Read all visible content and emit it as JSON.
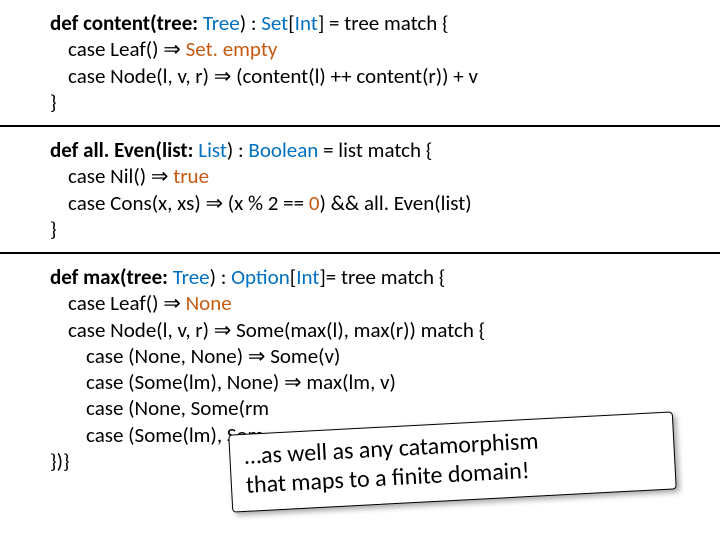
{
  "block1": {
    "l1_pre": "def content(tree: ",
    "l1_t1": "Tree",
    "l1_mid1": ") : ",
    "l1_t2": "Set",
    "l1_mid2": "[",
    "l1_t3": "Int",
    "l1_post": "] = tree match {",
    "l2_pre": "case Leaf() ⇒ ",
    "l2_lit": "Set. empty",
    "l3": "case Node(l, v, r) ⇒ (content(l) ++ content(r)) + v",
    "l4": "}"
  },
  "block2": {
    "l1_pre": "def all. Even(list: ",
    "l1_t1": "List",
    "l1_mid1": ") : ",
    "l1_t2": "Boolean",
    "l1_post": " = list match {",
    "l2_pre": "case Nil() ⇒ ",
    "l2_lit": "true",
    "l3_pre": "case Cons(x, xs) ⇒ (x % 2 == ",
    "l3_lit": "0",
    "l3_post": ") && all. Even(list)",
    "l4": "}"
  },
  "block3": {
    "l1_pre": "def max(tree: ",
    "l1_t1": "Tree",
    "l1_mid1": ") : ",
    "l1_t2": "Option",
    "l1_mid2": "[",
    "l1_t3": "Int",
    "l1_post": "]= tree match {",
    "l2_pre": "case Leaf() ⇒ ",
    "l2_lit": "None",
    "l3": "case Node(l, v, r) ⇒ Some(max(l), max(r)) match {",
    "l4": "case (None, None) ⇒ Some(v)",
    "l5": "case (Some(lm), None) ⇒ max(lm, v)",
    "l6": "case (None, Some(rm",
    "l7": "case (Some(lm), Som",
    "l8": "})}"
  },
  "callout": {
    "line1": "…as well as any catamorphism",
    "line2": "that maps to a finite domain!"
  }
}
